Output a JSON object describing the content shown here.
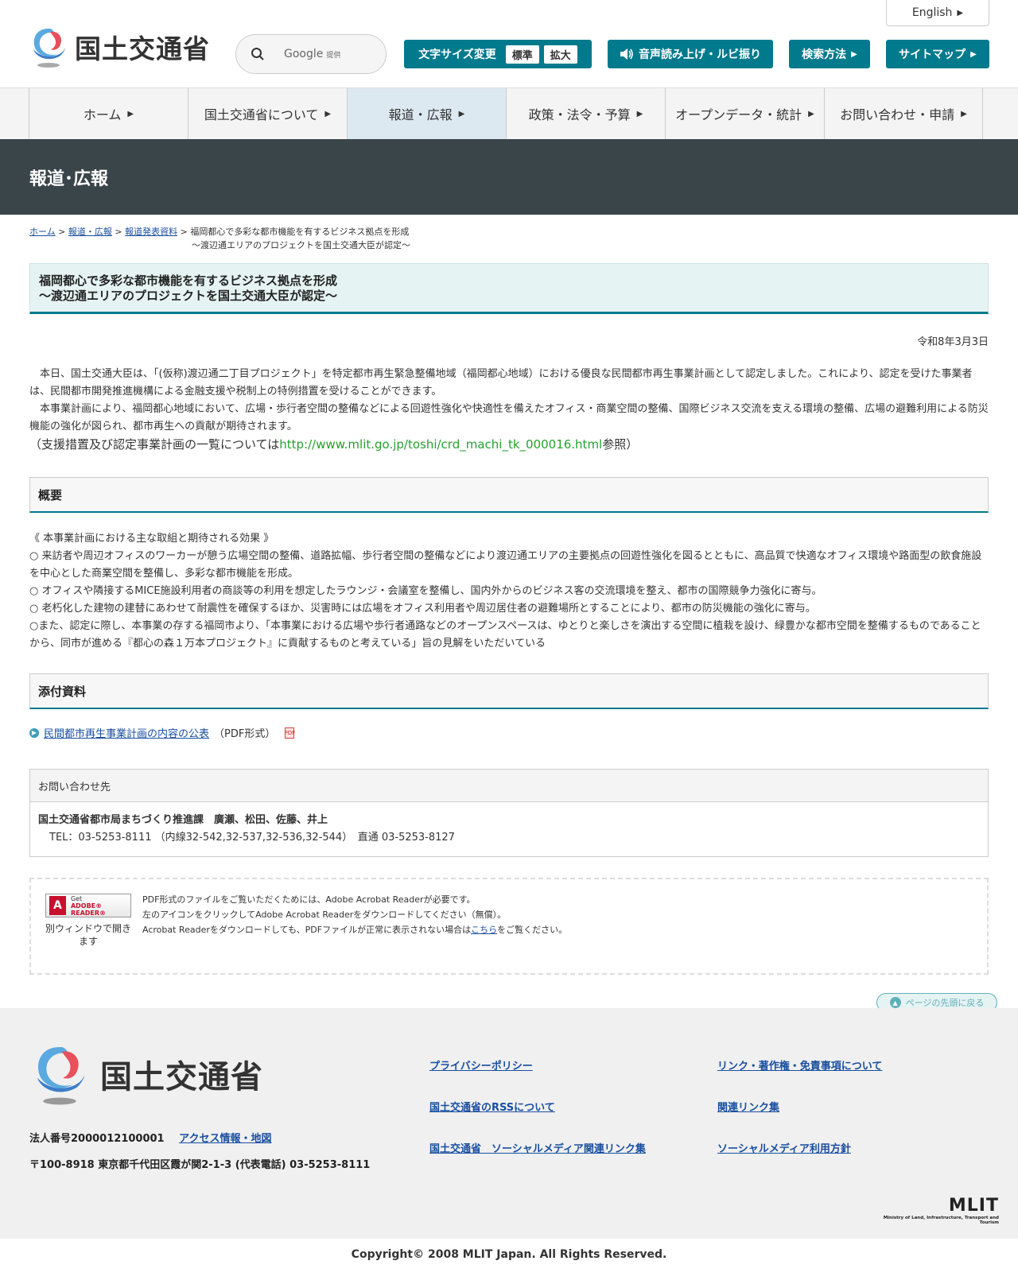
{
  "header": {
    "logo_text": "国土交通省",
    "english_label": "English",
    "search_placeholder": "Google",
    "search_provided": "提供",
    "font_size_label": "文字サイズ変更",
    "font_size_standard": "標準",
    "font_size_large": "拡大",
    "voice_label": "音声読み上げ・ルビ振り",
    "search_method_label": "検索方法",
    "sitemap_label": "サイトマップ"
  },
  "nav": {
    "items": [
      {
        "label": "ホーム"
      },
      {
        "label": "国土交通省について"
      },
      {
        "label": "報道・広報"
      },
      {
        "label": "政策・法令・予算"
      },
      {
        "label": "オープンデータ・統計"
      },
      {
        "label": "お問い合わせ・申請"
      }
    ],
    "active_index": 2
  },
  "page_title": "報道･広報",
  "breadcrumb": {
    "items": [
      "ホーム",
      "報道・広報",
      "報道発表資料"
    ],
    "current_line1": "福岡都心で多彩な都市機能を有するビジネス拠点を形成",
    "current_line2": "～渡辺通エリアのプロジェクトを国土交通大臣が認定～"
  },
  "article": {
    "title_line1": "福岡都心で多彩な都市機能を有するビジネス拠点を形成",
    "title_line2": "～渡辺通エリアのプロジェクトを国土交通大臣が認定～",
    "date": "令和8年3月3日",
    "para1": "　本日、国土交通大臣は、「(仮称)渡辺通二丁目プロジェクト」を特定都市再生緊急整備地域（福岡都心地域）における優良な民間都市再生事業計画として認定しました。これにより、認定を受けた事業者は、民間都市開発推進機構による金融支援や税制上の特例措置を受けることができます。",
    "para2": "　本事業計画により、福岡都心地域において、広場・歩行者空間の整備などによる回遊性強化や快適性を備えたオフィス・商業空間の整備、国際ビジネス交流を支える環境の整備、広場の避難利用による防災機能の強化が図られ、都市再生への貢献が期待されます。",
    "ref_prefix": "（支援措置及び認定事業計画の一覧については",
    "ref_url": "http://www.mlit.go.jp/toshi/crd_machi_tk_000016.html",
    "ref_suffix": "参照）"
  },
  "outline": {
    "heading": "概要",
    "intro": "《 本事業計画における主な取組と期待される効果 》",
    "points": [
      "○ 来訪者や周辺オフィスのワーカーが憩う広場空間の整備、道路拡幅、歩行者空間の整備などにより渡辺通エリアの主要拠点の回遊性強化を図るとともに、高品質で快適なオフィス環境や路面型の飲食施設を中心とした商業空間を整備し、多彩な都市機能を形成。",
      "○ オフィスや隣接するMICE施設利用者の商談等の利用を想定したラウンジ・会議室を整備し、国内外からのビジネス客の交流環境を整え、都市の国際競争力強化に寄与。",
      "○ 老朽化した建物の建替にあわせて耐震性を確保するほか、災害時には広場をオフィス利用者や周辺居住者の避難場所とすることにより、都市の防災機能の強化に寄与。",
      "○また、認定に際し、本事業の存する福岡市より、「本事業における広場や歩行者通路などのオープンスペースは、ゆとりと楽しさを演出する空間に植栽を設け、緑豊かな都市空間を整備するものであることから、同市が進める『都心の森１万本プロジェクト』に貢献するものと考えている」旨の見解をいただいている"
    ]
  },
  "attachments": {
    "heading": "添付資料",
    "link_label": "民間都市再生事業計画の内容の公表",
    "format": "（PDF形式）"
  },
  "contact": {
    "heading": "お問い合わせ先",
    "name": "国土交通省都市局まちづくり推進課　廣瀬、松田、佐藤、井上",
    "tel": "TEL：03-5253-8111 （内線32-542,32-537,32-536,32-544）　直通 03-5253-8127"
  },
  "adobe": {
    "badge_get": "Get",
    "badge_name": "ADOBE® READER®",
    "note": "別ウィンドウで開きます",
    "line1": "PDF形式のファイルをご覧いただくためには、Adobe Acrobat Readerが必要です。",
    "line2": "左のアイコンをクリックしてAdobe Acrobat Readerをダウンロードしてください（無償）。",
    "line3_prefix": "Acrobat Readerをダウンロードしても、PDFファイルが正常に表示されない場合は",
    "line3_link": "こちら",
    "line3_suffix": "をご覧ください。"
  },
  "to_top": "ページの先頭に戻る",
  "footer": {
    "logo_text": "国土交通省",
    "corp_number": "法人番号2000012100001",
    "access_link": "アクセス情報・地図",
    "address": "〒100-8918 東京都千代田区霞が関2-1-3 (代表電話) 03-5253-8111",
    "links": [
      "プライバシーポリシー",
      "リンク・著作権・免責事項について",
      "国土交通省のRSSについて",
      "関連リンク集",
      "国土交通省　ソーシャルメディア関連リンク集",
      "ソーシャルメディア利用方針"
    ],
    "mlit_mark": "MLIT",
    "mlit_full": "Ministry of Land, Infrastructure, Transport and Tourism",
    "copyright": "Copyright© 2008 MLIT Japan. All Rights Reserved."
  },
  "colors": {
    "accent": "#007a8c",
    "title_bar": "#3a454a",
    "link": "#1a4fa0",
    "url_green": "#27a02e"
  }
}
